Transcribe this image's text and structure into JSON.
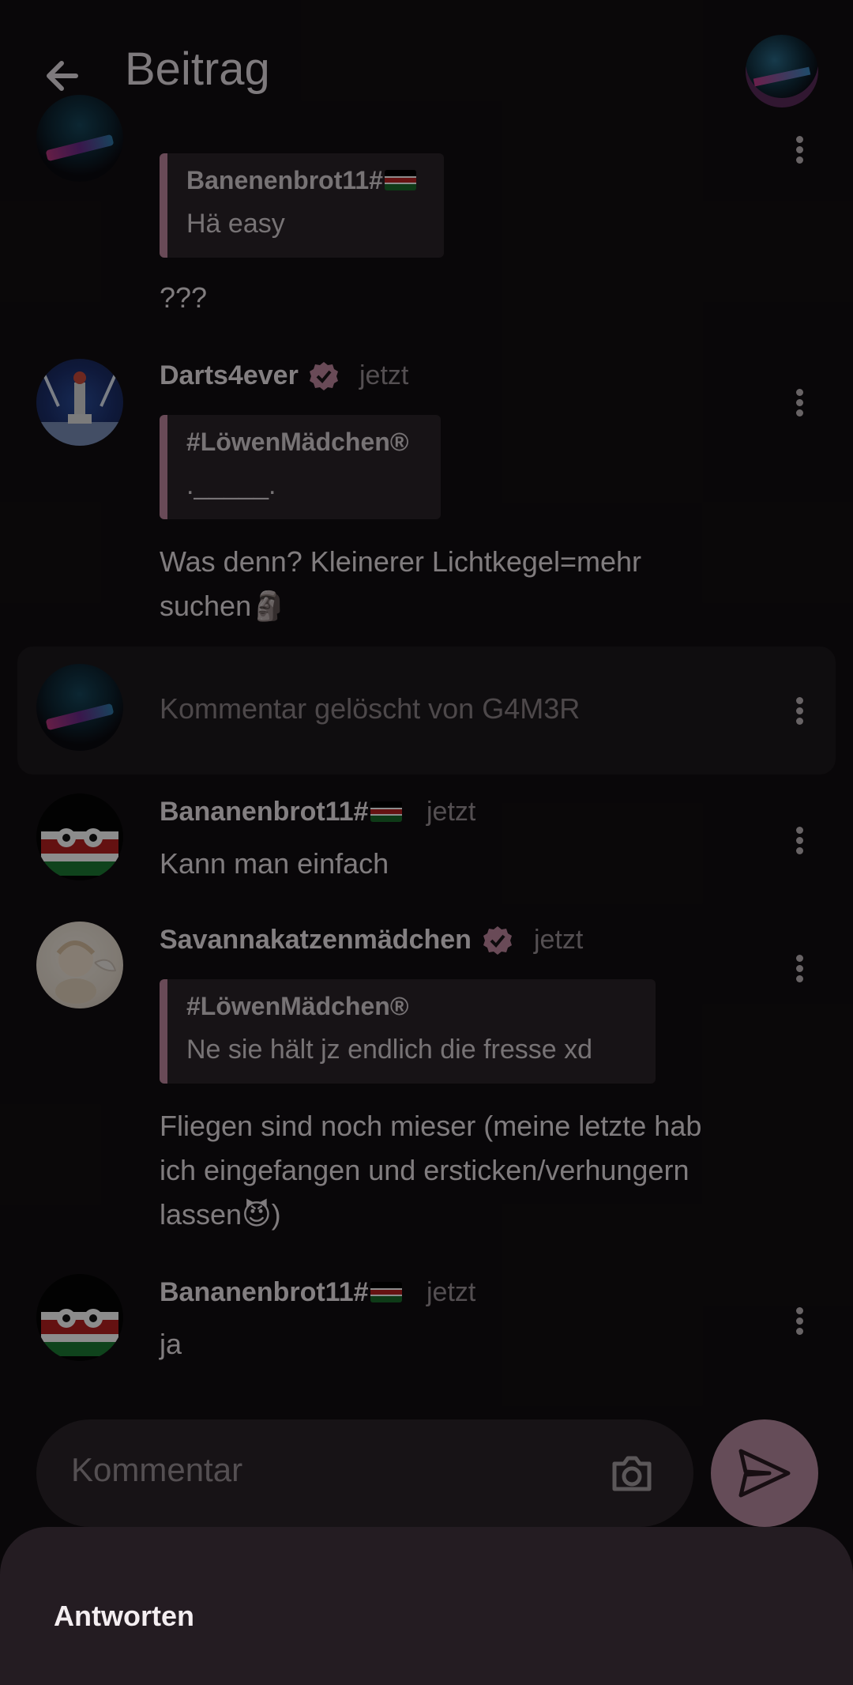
{
  "header": {
    "title": "Beitrag"
  },
  "comments": [
    {
      "quote": {
        "author": "Banenenbrot11#",
        "text": "Hä easy"
      },
      "text": "???"
    },
    {
      "name": "Darts4ever",
      "time": "jetzt",
      "quote": {
        "author": "#LöwenMädchen®",
        "text": "._____."
      },
      "text_line1": "Was denn? Kleinerer Lichtkegel=mehr",
      "text_line2": "suchen🗿"
    },
    {
      "deleted_text": "Kommentar gelöscht von G4M3R"
    },
    {
      "name": "Bananenbrot11#",
      "time": "jetzt",
      "text": "Kann man einfach"
    },
    {
      "name": "Savannakatzenmädchen",
      "time": "jetzt",
      "quote": {
        "author": "#LöwenMädchen®",
        "text": "Ne sie hält jz endlich die fresse xd"
      },
      "text_line1": "Fliegen sind noch mieser (meine letzte hab",
      "text_line2": "ich eingefangen und ersticken/verhungern",
      "text_line3": "lassen😈)"
    },
    {
      "name": "Bananenbrot11#",
      "time": "jetzt",
      "text": "ja"
    }
  ],
  "composer": {
    "placeholder": "Kommentar"
  },
  "sheet": {
    "action": "Antworten"
  },
  "colors": {
    "accent": "#b98aa0",
    "quote_bar": "#c0889e",
    "background": "#120e11"
  }
}
